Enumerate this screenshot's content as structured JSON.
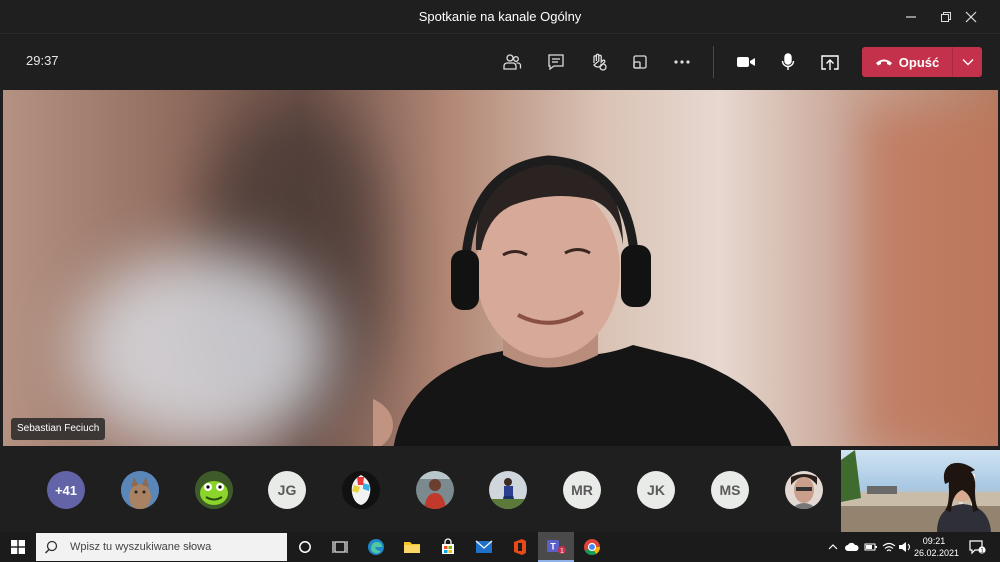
{
  "window": {
    "title": "Spotkanie na kanale Ogólny",
    "controls": [
      "minimize-icon",
      "restore-icon",
      "close-icon"
    ]
  },
  "toolbar": {
    "timer": "29:37",
    "icons": [
      "people-icon",
      "chat-icon",
      "raise-hand-icon",
      "breakout-rooms-icon",
      "more-icon",
      "camera-icon",
      "microphone-icon",
      "share-icon"
    ],
    "leave_label": "Opuść",
    "leave_color": "#c4314b"
  },
  "video": {
    "speaker_name": "Sebastian Feciuch"
  },
  "participants": {
    "overflow": "+41",
    "items": [
      {
        "type": "photo",
        "icon": "cat-avatar"
      },
      {
        "type": "photo",
        "icon": "green-monster-avatar"
      },
      {
        "type": "initials",
        "text": "JG"
      },
      {
        "type": "photo",
        "icon": "logo-avatar"
      },
      {
        "type": "photo",
        "icon": "person-avatar"
      },
      {
        "type": "photo",
        "icon": "person-avatar"
      },
      {
        "type": "initials",
        "text": "MR"
      },
      {
        "type": "initials",
        "text": "JK"
      },
      {
        "type": "initials",
        "text": "MS"
      },
      {
        "type": "photo",
        "icon": "person-avatar"
      }
    ]
  },
  "taskbar": {
    "search_placeholder": "Wpisz tu wyszukiwane słowa",
    "time": "09:21",
    "date": "26.02.2021",
    "teams_badge": "1",
    "notifications_badge": "1"
  }
}
